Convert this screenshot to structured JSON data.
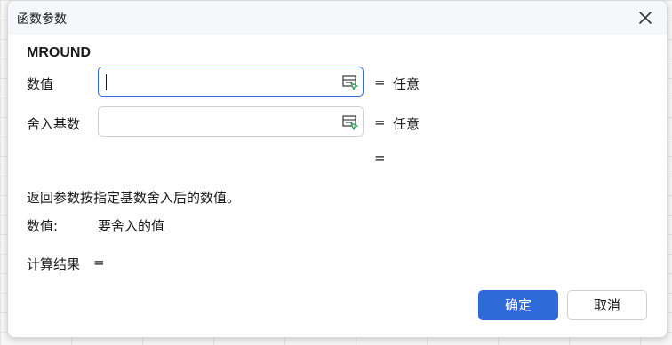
{
  "dialog": {
    "title": "函数参数",
    "function_name": "MROUND"
  },
  "arguments": [
    {
      "label": "数值",
      "value": "",
      "equals": "=",
      "result": "任意"
    },
    {
      "label": "舍入基数",
      "value": "",
      "equals": "=",
      "result": "任意"
    }
  ],
  "formula_equals": "=",
  "description": "返回参数按指定基数舍入后的数值。",
  "param_help": {
    "name": "数值:",
    "text": "要舍入的值"
  },
  "calc_result": {
    "label": "计算结果",
    "equals": "="
  },
  "buttons": {
    "ok": "确定",
    "cancel": "取消"
  },
  "colors": {
    "accent": "#2f6ad9",
    "ref_icon_green": "#2e9e5b"
  },
  "icons": {
    "close": "close-icon",
    "ref": "range-select-icon"
  }
}
